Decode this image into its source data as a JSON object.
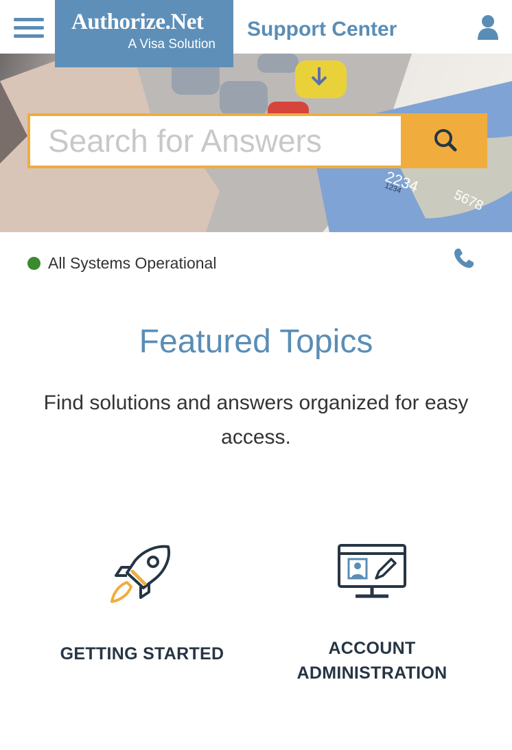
{
  "header": {
    "logo_main": "Authorize.Net",
    "logo_sub": "A Visa Solution",
    "title": "Support Center",
    "menu_icon": "hamburger-menu-icon",
    "user_icon": "user-icon"
  },
  "search": {
    "placeholder": "Search for Answers",
    "value": "",
    "icon": "search-icon"
  },
  "status": {
    "text": "All Systems Operational",
    "indicator_color": "#3a8a2e",
    "phone_icon": "phone-icon"
  },
  "featured": {
    "title": "Featured Topics",
    "description": "Find solutions and answers organized for easy access."
  },
  "topics": [
    {
      "label": "GETTING STARTED",
      "icon": "rocket-icon"
    },
    {
      "label": "ACCOUNT ADMINISTRATION",
      "icon": "monitor-edit-icon"
    }
  ],
  "colors": {
    "brand_blue": "#5e8fb8",
    "accent_orange": "#f0ad3d",
    "heading_dark": "#263544",
    "status_green": "#3a8a2e"
  }
}
